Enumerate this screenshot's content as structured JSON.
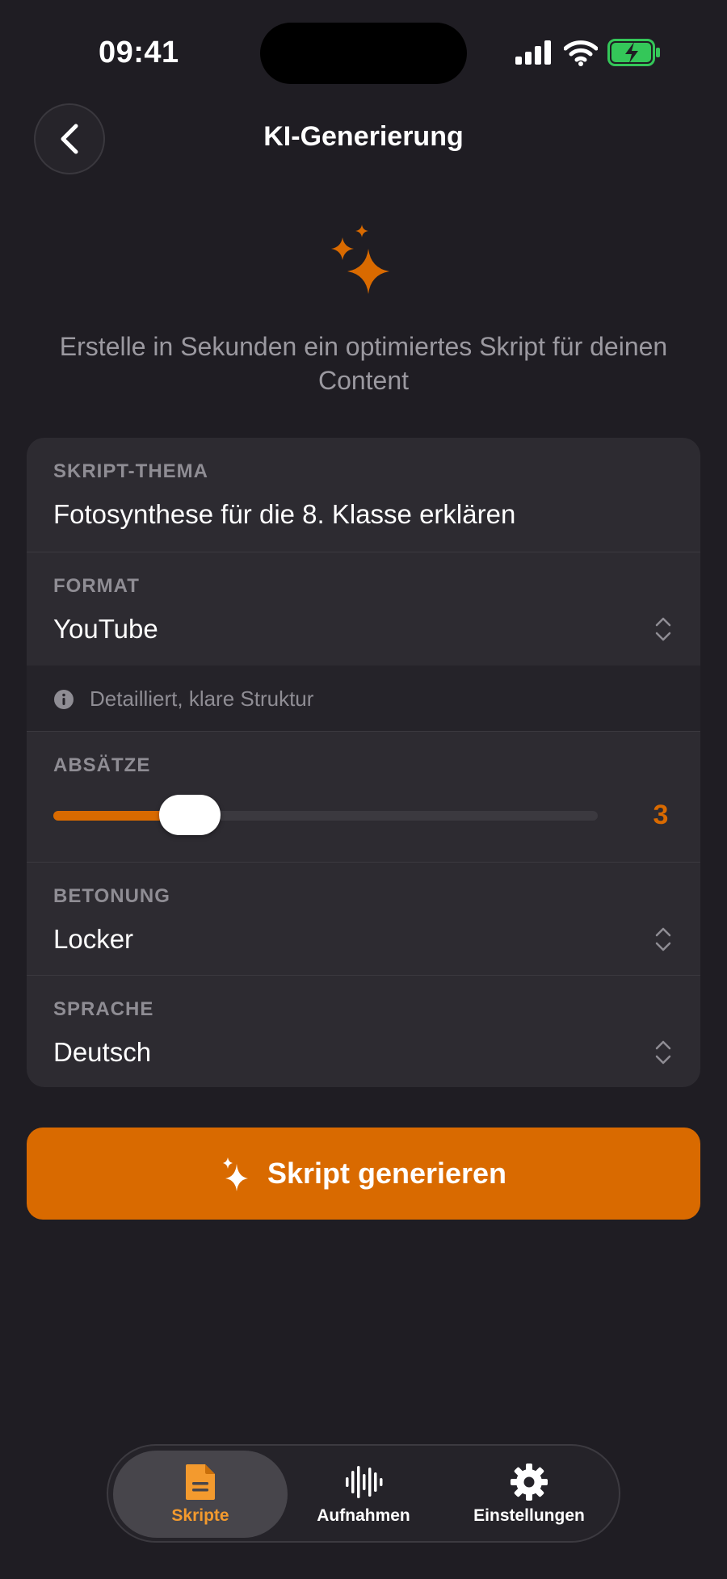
{
  "status_bar": {
    "time": "09:41"
  },
  "header": {
    "title": "KI-Generierung"
  },
  "hero": {
    "subtitle": "Erstelle in Sekunden ein optimiertes Skript für deinen Content"
  },
  "form": {
    "topic": {
      "label": "SKRIPT-THEMA",
      "value": "Fotosynthese für die 8. Klasse erklären"
    },
    "format": {
      "label": "FORMAT",
      "value": "YouTube",
      "hint": "Detailliert, klare Struktur"
    },
    "paragraphs": {
      "label": "ABSÄTZE",
      "value": "3",
      "slider_fraction": 0.25
    },
    "tone": {
      "label": "BETONUNG",
      "value": "Locker"
    },
    "language": {
      "label": "SPRACHE",
      "value": "Deutsch"
    }
  },
  "cta": {
    "label": "Skript generieren"
  },
  "tabs": [
    {
      "label": "Skripte",
      "icon": "document-icon",
      "active": true
    },
    {
      "label": "Aufnahmen",
      "icon": "waveform-icon",
      "active": false
    },
    {
      "label": "Einstellungen",
      "icon": "gear-icon",
      "active": false
    }
  ],
  "colors": {
    "accent": "#d96a00",
    "background": "#1f1d23",
    "card": "#2d2b31",
    "muted_text": "#8f8d94",
    "battery_green": "#34c759"
  }
}
